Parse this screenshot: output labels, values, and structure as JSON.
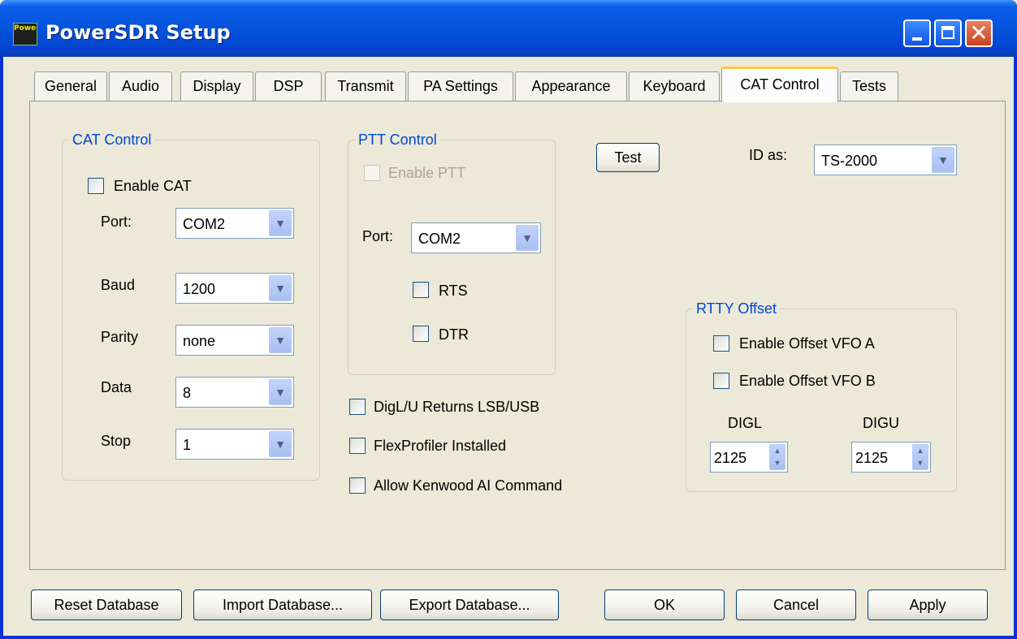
{
  "window": {
    "title": "PowerSDR Setup",
    "icon": "powersdr-app-icon",
    "icon_text": "PowerSDR"
  },
  "tabs": [
    "General",
    "Audio",
    "Display",
    "DSP",
    "Transmit",
    "PA Settings",
    "Appearance",
    "Keyboard",
    "CAT Control",
    "Tests"
  ],
  "active_tab": "CAT Control",
  "cat_control": {
    "title": "CAT Control",
    "enable_label": "Enable CAT",
    "enable_checked": false,
    "port_label": "Port:",
    "port_value": "COM2",
    "baud_label": "Baud",
    "baud_value": "1200",
    "parity_label": "Parity",
    "parity_value": "none",
    "data_label": "Data",
    "data_value": "8",
    "stop_label": "Stop",
    "stop_value": "1"
  },
  "ptt_control": {
    "title": "PTT Control",
    "enable_label": "Enable PTT",
    "enable_checked": false,
    "enable_disabled": true,
    "port_label": "Port:",
    "port_value": "COM2",
    "rts_label": "RTS",
    "rts_checked": false,
    "dtr_label": "DTR",
    "dtr_checked": false
  },
  "test_button": "Test",
  "id_as": {
    "label": "ID as:",
    "value": "TS-2000"
  },
  "options": {
    "digl_label": "DigL/U Returns LSB/USB",
    "flexprofiler_label": "FlexProfiler Installed",
    "kenwood_ai_label": "Allow Kenwood AI Command"
  },
  "rtty_offset": {
    "title": "RTTY Offset",
    "vfo_a_label": "Enable Offset VFO A",
    "vfo_b_label": "Enable Offset VFO B",
    "digl_label": "DIGL",
    "digl_value": "2125",
    "digu_label": "DIGU",
    "digu_value": "2125"
  },
  "footer": {
    "reset": "Reset Database",
    "import": "Import Database...",
    "export": "Export Database...",
    "ok": "OK",
    "cancel": "Cancel",
    "apply": "Apply"
  },
  "colors": {
    "titlebar": "#0653dc",
    "group_title": "#0046d5",
    "window_bg": "#ece9d8",
    "active_tab_accent": "#ffc83c"
  }
}
